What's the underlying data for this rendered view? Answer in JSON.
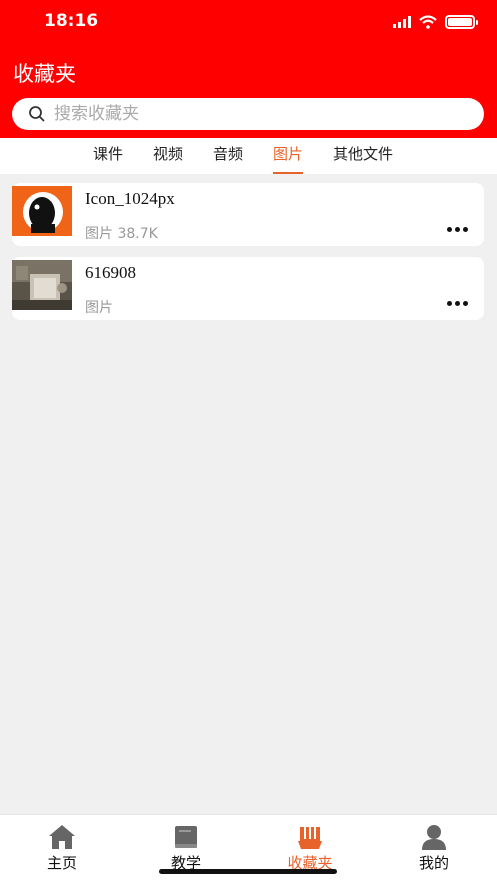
{
  "status_bar": {
    "time": "18:16"
  },
  "header": {
    "title": "收藏夹"
  },
  "search": {
    "placeholder": "搜索收藏夹"
  },
  "tabs": [
    {
      "label": "课件"
    },
    {
      "label": "视频"
    },
    {
      "label": "音频"
    },
    {
      "label": "图片"
    },
    {
      "label": "其他文件"
    }
  ],
  "active_tab": "图片",
  "items": [
    {
      "name": "Icon_1024px",
      "type": "图片",
      "size": "38.7K",
      "thumb_icon": "orange-silhouette-thumbnail"
    },
    {
      "name": "616908",
      "type": "图片",
      "size": "",
      "thumb_icon": "photo-thumbnail"
    }
  ],
  "tabbar": [
    {
      "label": "主页",
      "icon": "home-icon"
    },
    {
      "label": "教学",
      "icon": "book-icon"
    },
    {
      "label": "收藏夹",
      "icon": "favorites-icon"
    },
    {
      "label": "我的",
      "icon": "profile-icon"
    }
  ],
  "colors": {
    "header": "#ff0000",
    "accent": "#e8622b",
    "background": "#f0f0f0"
  }
}
